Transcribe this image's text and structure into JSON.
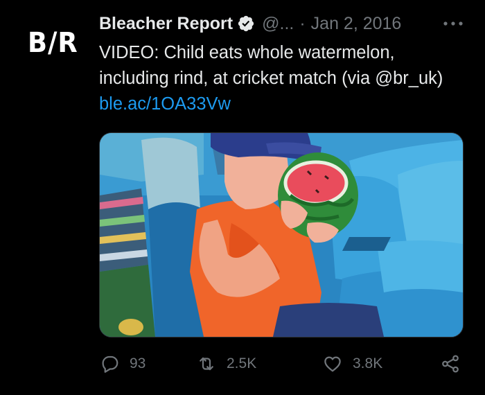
{
  "tweet": {
    "avatar_text": "B/R",
    "display_name": "Bleacher Report",
    "handle": "@...",
    "separator": "·",
    "date": "Jan 2, 2016",
    "text_main": "VIDEO: Child eats whole watermelon, including rind, at cricket match (via @br_uk) ",
    "text_link": "ble.ac/1OA33Vw",
    "media_icon": "photo-thumbnail",
    "actions": {
      "reply_count": "93",
      "retweet_count": "2.5K",
      "like_count": "3.8K"
    }
  },
  "colors": {
    "background": "#000000",
    "primary_text": "#e7e9ea",
    "secondary_text": "#71767b",
    "link": "#1d9bf0"
  }
}
